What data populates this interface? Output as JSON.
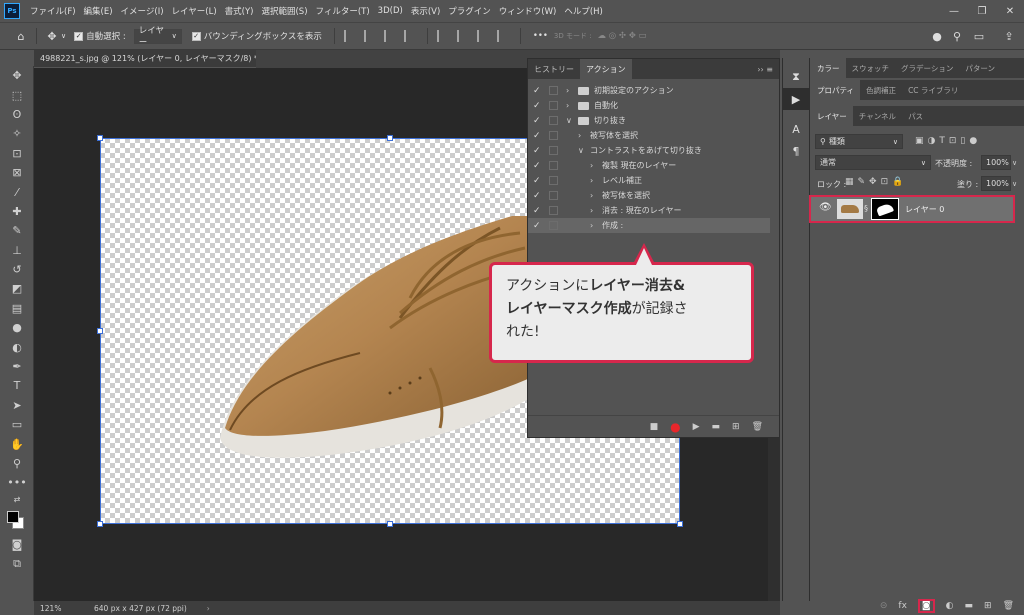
{
  "app": {
    "logo": "Ps"
  },
  "menu": [
    "ファイル(F)",
    "編集(E)",
    "イメージ(I)",
    "レイヤー(L)",
    "書式(Y)",
    "選択範囲(S)",
    "フィルター(T)",
    "3D(D)",
    "表示(V)",
    "プラグイン",
    "ウィンドウ(W)",
    "ヘルプ(H)"
  ],
  "window_controls": [
    "—",
    "❐",
    "✕"
  ],
  "options": {
    "auto_select_label": "自動選択 :",
    "auto_select_value": "レイヤー",
    "bbox_label": "バウンディングボックスを表示",
    "three_d_mode": "3D モード :"
  },
  "document": {
    "tab_title": "4988221_s.jpg @ 121% (レイヤー 0, レイヤーマスク/8) *",
    "close": "×"
  },
  "status": {
    "zoom": "121%",
    "info": "640 px x 427 px (72 ppi)"
  },
  "actions_panel": {
    "tabs": [
      "ヒストリー",
      "アクション"
    ],
    "rows": [
      {
        "label": "初期設定のアクション",
        "level": 0,
        "folder": true,
        "checked": true
      },
      {
        "label": "自動化",
        "level": 0,
        "folder": true,
        "checked": true
      },
      {
        "label": "切り抜き",
        "level": 0,
        "folder": true,
        "open": true,
        "checked": true
      },
      {
        "label": "被写体を選択",
        "level": 1,
        "checked": true
      },
      {
        "label": "コントラストをあげて切り抜き",
        "level": 1,
        "open": true,
        "checked": true
      },
      {
        "label": "複製 現在のレイヤー",
        "level": 2,
        "checked": true
      },
      {
        "label": "レベル補正",
        "level": 2,
        "checked": true
      },
      {
        "label": "被写体を選択",
        "level": 2,
        "checked": true
      },
      {
        "label": "消去 : 現在のレイヤー",
        "level": 2,
        "checked": true
      },
      {
        "label": "作成 :",
        "level": 2,
        "checked": true,
        "selected": true
      }
    ]
  },
  "callout": {
    "line1_pre": "アクションに",
    "line1_bold": "レイヤー消去&",
    "line2_bold": "レイヤーマスク作成",
    "line2_post": "が記録さ",
    "line3": "れた!"
  },
  "right_panels": {
    "top_tabs": [
      "カラー",
      "スウォッチ",
      "グラデーション",
      "パターン"
    ],
    "mid_tabs": [
      "プロパティ",
      "色調補正",
      "CC ライブラリ"
    ],
    "layer_tabs": [
      "レイヤー",
      "チャンネル",
      "パス"
    ],
    "filter_kind": "種類",
    "blend_mode": "通常",
    "opacity_label": "不透明度 :",
    "opacity_value": "100%",
    "lock_label": "ロック :",
    "fill_label": "塗り :",
    "fill_value": "100%",
    "layer_name": "レイヤー 0"
  },
  "colors": {
    "highlight": "#d6274c",
    "panel": "#535353",
    "canvas_bg": "#282828"
  }
}
